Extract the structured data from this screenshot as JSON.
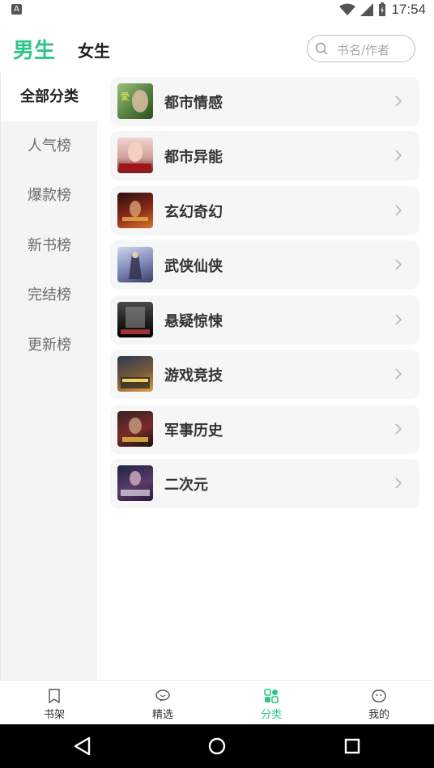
{
  "status_bar": {
    "left_icon": "A",
    "time": "17:54"
  },
  "header": {
    "tabs": [
      {
        "label": "男生"
      },
      {
        "label": "女生"
      }
    ],
    "search": {
      "placeholder": "书名/作者"
    }
  },
  "sidebar": {
    "items": [
      {
        "label": "全部分类"
      },
      {
        "label": "人气榜"
      },
      {
        "label": "爆款榜"
      },
      {
        "label": "新书榜"
      },
      {
        "label": "完结榜"
      },
      {
        "label": "更新榜"
      }
    ]
  },
  "categories": [
    {
      "label": "都市情感"
    },
    {
      "label": "都市异能"
    },
    {
      "label": "玄幻奇幻"
    },
    {
      "label": "武侠仙侠"
    },
    {
      "label": "悬疑惊悚"
    },
    {
      "label": "游戏竞技"
    },
    {
      "label": "军事历史"
    },
    {
      "label": "二次元"
    }
  ],
  "bottom_nav": {
    "items": [
      {
        "label": "书架",
        "icon": "bookmark-icon"
      },
      {
        "label": "精选",
        "icon": "chat-heart-icon"
      },
      {
        "label": "分类",
        "icon": "grid-icon"
      },
      {
        "label": "我的",
        "icon": "face-icon"
      }
    ]
  },
  "colors": {
    "accent": "#2cc68a",
    "sidebar_bg": "#f4f4f4",
    "row_bg": "#f6f6f6"
  }
}
